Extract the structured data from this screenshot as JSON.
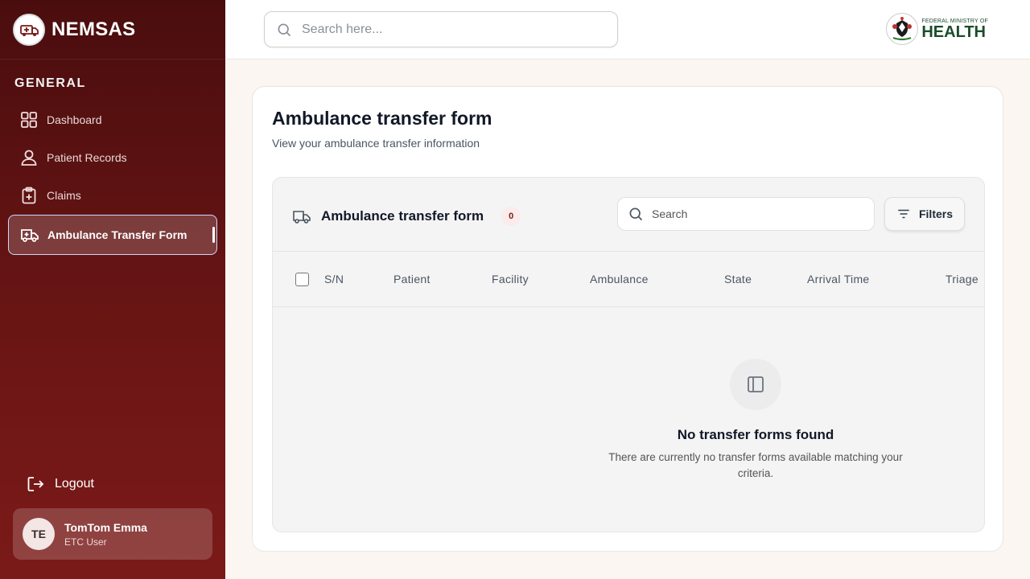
{
  "brand": {
    "name": "NEMSAS"
  },
  "sidebar": {
    "section_title": "GENERAL",
    "items": [
      {
        "label": "Dashboard",
        "icon": "grid-icon"
      },
      {
        "label": "Patient Records",
        "icon": "user-icon"
      },
      {
        "label": "Claims",
        "icon": "clipboard-plus-icon"
      },
      {
        "label": "Ambulance Transfer Form",
        "icon": "ambulance-icon",
        "active": true
      }
    ],
    "logout_label": "Logout",
    "user": {
      "initials": "TE",
      "name": "TomTom Emma",
      "role": "ETC User"
    }
  },
  "topbar": {
    "search_placeholder": "Search here...",
    "ministry_small": "FEDERAL MINISTRY OF",
    "ministry_big": "HEALTH"
  },
  "main": {
    "title": "Ambulance transfer form",
    "subtitle": "View your ambulance transfer information",
    "panel": {
      "title": "Ambulance transfer form",
      "count": "0",
      "search_placeholder": "Search",
      "filters_label": "Filters",
      "columns": [
        "S/N",
        "Patient",
        "Facility",
        "Ambulance",
        "State",
        "Arrival Time",
        "Triage"
      ],
      "empty_title": "No transfer forms found",
      "empty_desc": "There are currently no transfer forms available matching your criteria."
    }
  },
  "colors": {
    "sidebar_dark": "#4a0d0e",
    "sidebar_light": "#7a1a18",
    "accent_border": "#cfd6ff"
  }
}
